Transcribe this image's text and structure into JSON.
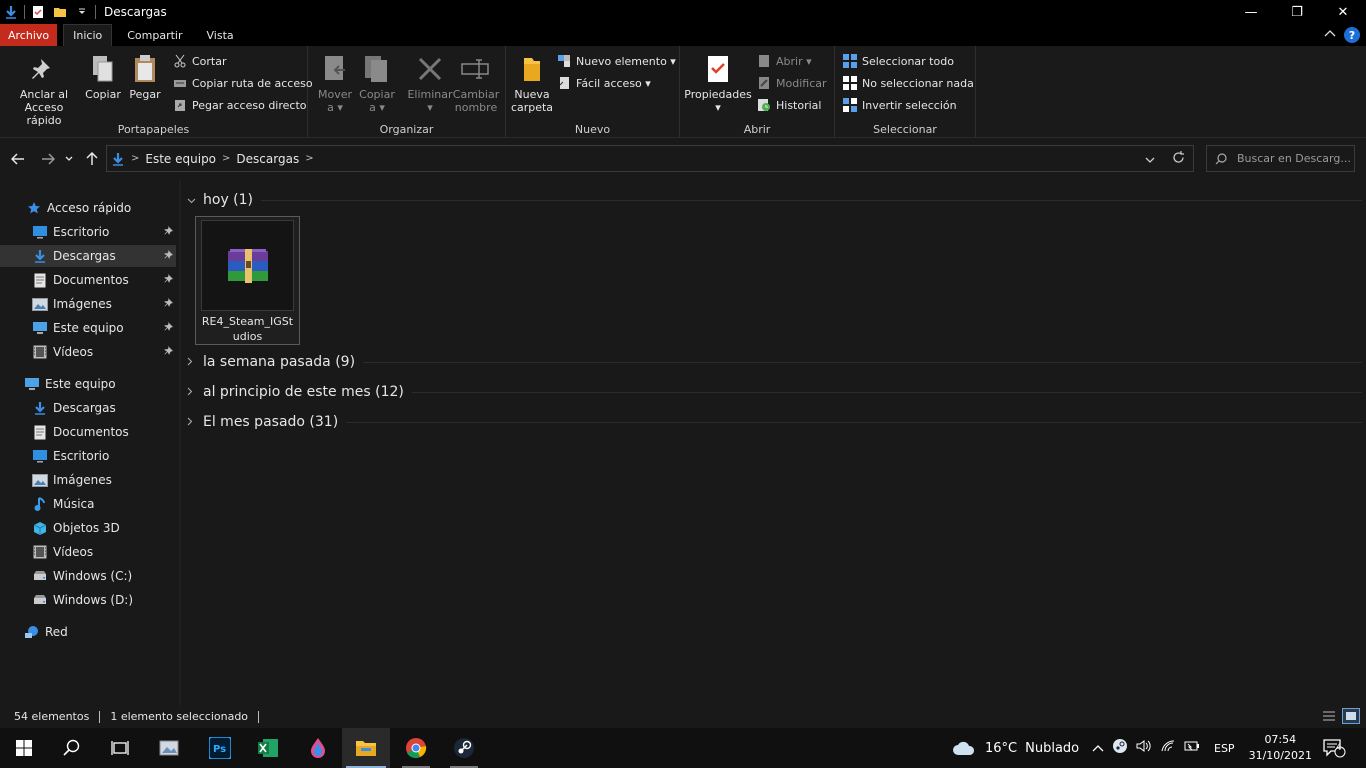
{
  "window": {
    "title": "Descargas",
    "controls": {
      "minimize": "—",
      "maximize": "❐",
      "close": "✕"
    }
  },
  "ribbon_tabs": {
    "file": "Archivo",
    "home": "Inicio",
    "share": "Compartir",
    "view": "Vista"
  },
  "ribbon": {
    "clipboard": {
      "label": "Portapapeles",
      "pin_l1": "Anclar al",
      "pin_l2": "Acceso rápido",
      "copy": "Copiar",
      "paste": "Pegar",
      "cut": "Cortar",
      "copy_path": "Copiar ruta de acceso",
      "paste_shortcut": "Pegar acceso directo"
    },
    "organize": {
      "label": "Organizar",
      "move_l1": "Mover",
      "move_l2": "a ▾",
      "copyto_l1": "Copiar",
      "copyto_l2": "a ▾",
      "delete_l1": "Eliminar",
      "delete_l2": "▾",
      "rename_l1": "Cambiar",
      "rename_l2": "nombre"
    },
    "new": {
      "label": "Nuevo",
      "folder_l1": "Nueva",
      "folder_l2": "carpeta",
      "new_item": "Nuevo elemento ▾",
      "easy_access": "Fácil acceso ▾"
    },
    "open": {
      "label": "Abrir",
      "props_l1": "Propiedades",
      "props_l2": "▾",
      "open": "Abrir ▾",
      "edit": "Modificar",
      "history": "Historial"
    },
    "select": {
      "label": "Seleccionar",
      "all": "Seleccionar todo",
      "none": "No seleccionar nada",
      "invert": "Invertir selección"
    }
  },
  "address": {
    "crumbs": [
      "Este equipo",
      "Descargas"
    ],
    "search_placeholder": "Buscar en Descarg..."
  },
  "nav": {
    "quick_access": "Acceso rápido",
    "quick_items": [
      {
        "label": "Escritorio",
        "icon": "desktop-icon"
      },
      {
        "label": "Descargas",
        "icon": "download-icon"
      },
      {
        "label": "Documentos",
        "icon": "document-icon"
      },
      {
        "label": "Imágenes",
        "icon": "pictures-icon"
      },
      {
        "label": "Este equipo",
        "icon": "computer-icon"
      },
      {
        "label": "Vídeos",
        "icon": "video-icon"
      }
    ],
    "this_pc": "Este equipo",
    "pc_items": [
      {
        "label": "Descargas",
        "icon": "download-icon"
      },
      {
        "label": "Documentos",
        "icon": "document-icon"
      },
      {
        "label": "Escritorio",
        "icon": "desktop-icon"
      },
      {
        "label": "Imágenes",
        "icon": "pictures-icon"
      },
      {
        "label": "Música",
        "icon": "music-icon"
      },
      {
        "label": "Objetos 3D",
        "icon": "cube-icon"
      },
      {
        "label": "Vídeos",
        "icon": "video-icon"
      },
      {
        "label": "Windows (C:)",
        "icon": "drive-icon"
      },
      {
        "label": "Windows (D:)",
        "icon": "drive-icon"
      }
    ],
    "network": "Red"
  },
  "content": {
    "groups": [
      {
        "label": "hoy (1)",
        "expanded": true
      },
      {
        "label": "la semana pasada (9)",
        "expanded": false
      },
      {
        "label": "al principio de este mes (12)",
        "expanded": false
      },
      {
        "label": "El mes pasado (31)",
        "expanded": false
      }
    ],
    "file": {
      "name": "RE4_Steam_IGStudios",
      "icon": "winrar-archive-icon"
    }
  },
  "status": {
    "count": "54 elementos",
    "selected": "1 elemento seleccionado"
  },
  "taskbar": {
    "weather_temp": "16°C",
    "weather_desc": "Nublado",
    "language": "ESP",
    "time": "07:54",
    "date": "31/10/2021",
    "notifications": "4"
  },
  "colors": {
    "accent_file_tab": "#c42b1c",
    "selection": "#333333",
    "help": "#1e6ed8"
  }
}
